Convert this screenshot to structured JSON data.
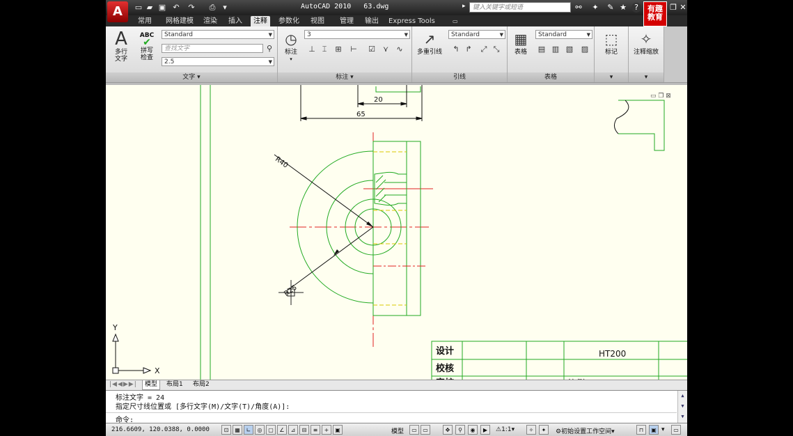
{
  "titlebar": {
    "title": "AutoCAD 2010   63.dwg",
    "search_placeholder": "键入关键字或短语",
    "brand": "有趣教育"
  },
  "tabs": [
    "常用",
    "网格建模",
    "渲染",
    "插入",
    "注释",
    "参数化",
    "视图",
    "管理",
    "输出",
    "Express Tools"
  ],
  "ribbon": {
    "text_panel": {
      "mtext_label": "多行\n文字",
      "spell_label": "拼写\n检查",
      "spell_icon_text": "ABC",
      "style": "Standard",
      "find_placeholder": "查找文字",
      "height": "2.5",
      "title": "文字"
    },
    "dim_panel": {
      "dim_label": "标注",
      "style": "3",
      "title": "标注"
    },
    "leader_panel": {
      "mleader_label": "多重引线",
      "style": "Standard",
      "title": "引线"
    },
    "table_panel": {
      "table_label": "表格",
      "style": "Standard",
      "title": "表格"
    },
    "markup_panel": {
      "label": "标记"
    },
    "scale_panel": {
      "label": "注释缩放"
    }
  },
  "drawing": {
    "dim_20": "20",
    "dim_65": "65",
    "r40": "R40",
    "r25": "R25",
    "axis_x": "X",
    "axis_y": "Y",
    "tb_design": "设计",
    "tb_check": "校核",
    "tb_material": "HT200",
    "tb_cut1": "审核",
    "tb_cut2": "比例"
  },
  "layout_tabs": [
    "模型",
    "布局1",
    "布局2"
  ],
  "command": {
    "line1": "标注文字 = 24",
    "line2": "指定尺寸线位置或 [多行文字(M)/文字(T)/角度(A)]:",
    "prompt": "命令:"
  },
  "status": {
    "coords": "216.6609, 120.0388, 0.0000",
    "model": "模型",
    "scale": "1:1",
    "workspace": "初始设置工作空间"
  },
  "colors": {
    "canvas": "#fffff0",
    "geometry": "#22aa22",
    "centerline": "#e02020",
    "hidden": "#d8c800",
    "dimension": "#111111"
  }
}
